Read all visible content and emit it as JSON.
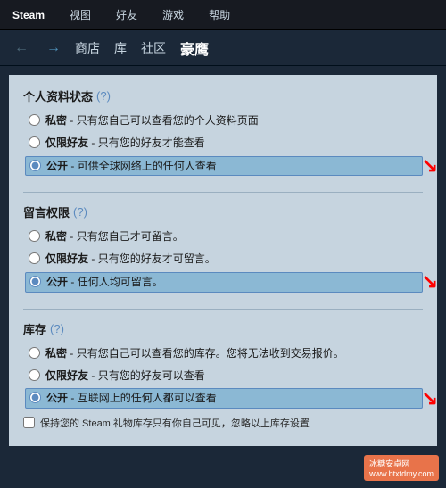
{
  "menubar": {
    "items": [
      {
        "label": "Steam",
        "id": "steam"
      },
      {
        "label": "视图",
        "id": "view"
      },
      {
        "label": "好友",
        "id": "friends"
      },
      {
        "label": "游戏",
        "id": "games"
      },
      {
        "label": "帮助",
        "id": "help"
      }
    ]
  },
  "navbar": {
    "back_arrow": "←",
    "forward_arrow": "→",
    "links": [
      {
        "label": "商店",
        "id": "store"
      },
      {
        "label": "库",
        "id": "library"
      },
      {
        "label": "社区",
        "id": "community"
      }
    ],
    "username": "豪鹰"
  },
  "sections": [
    {
      "id": "profile-status",
      "title": "个人资料状态",
      "question": "(?)",
      "options": [
        {
          "id": "private",
          "label": "私密",
          "description": "只有您自己可以查看您的个人资料页面",
          "selected": false
        },
        {
          "id": "friends-only",
          "label": "仅限好友",
          "description": "只有您的好友才能查看",
          "selected": false
        },
        {
          "id": "public",
          "label": "公开",
          "description": "可供全球网络上的任何人查看",
          "selected": true
        }
      ]
    },
    {
      "id": "comment-permission",
      "title": "留言权限",
      "question": "(?)",
      "options": [
        {
          "id": "private",
          "label": "私密",
          "description": "只有您自己才可留言。",
          "selected": false
        },
        {
          "id": "friends-only",
          "label": "仅限好友",
          "description": "只有您的好友才可留言。",
          "selected": false
        },
        {
          "id": "public",
          "label": "公开",
          "description": "任何人均可留言。",
          "selected": true
        }
      ]
    },
    {
      "id": "inventory",
      "title": "库存",
      "question": "(?)",
      "options": [
        {
          "id": "private",
          "label": "私密",
          "description": "只有您自己可以查看您的库存。您将无法收到交易报价。",
          "selected": false
        },
        {
          "id": "friends-only",
          "label": "仅限好友",
          "description": "只有您的好友可以查看",
          "selected": false
        },
        {
          "id": "public",
          "label": "公开",
          "description": "互联网上的任何人都可以查看",
          "selected": true
        }
      ]
    }
  ],
  "gift_checkbox": {
    "label": "保持您的 Steam 礼物库存只有你自己可见，忽略以上库存设置"
  },
  "watermark": {
    "line1": "冰糖安卓网",
    "line2": "www.btxtdmy.com"
  },
  "colors": {
    "selected_bg": "#8bb8d4",
    "selected_border": "#5b8abf",
    "arrow_color": "#ff0000"
  }
}
